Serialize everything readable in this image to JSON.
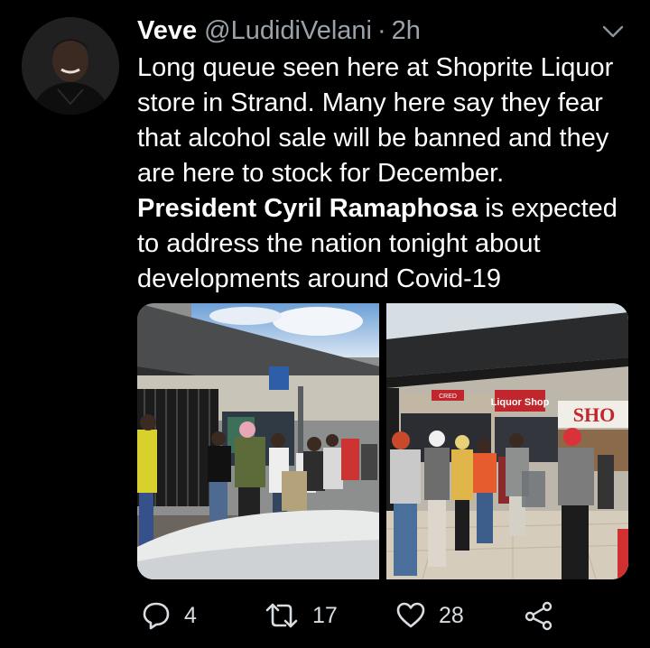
{
  "tweet": {
    "author_name": "Veve",
    "handle": "@LudidiVelani",
    "separator": "·",
    "time": "2h",
    "lines": [
      "Long queue seen here at Shoprite Liquor",
      "store in Strand. Many here say they fear",
      "that alcohol sale will be banned and they",
      "are here to stock for December."
    ],
    "bold_mention": "President Cyril Ramaphosa",
    "line5_rest": " is expected",
    "lines_after": [
      "to address the nation tonight about",
      "developments around Covid-19"
    ],
    "signs": {
      "liquor_sign": "Liquor Shop",
      "shoprite_sign": "SHO",
      "small_sign": "CRED"
    }
  },
  "actions": {
    "reply_count": "4",
    "retweet_count": "17",
    "like_count": "28"
  },
  "icons": {
    "reply": "speech-bubble-icon",
    "retweet": "retweet-arrows-icon",
    "like": "heart-icon",
    "share": "share-nodes-icon",
    "menu": "chevron-down-icon"
  },
  "colors": {
    "background": "#000000",
    "text": "#ffffff",
    "secondary": "#9aa3ab",
    "icon": "#d8dde1"
  }
}
